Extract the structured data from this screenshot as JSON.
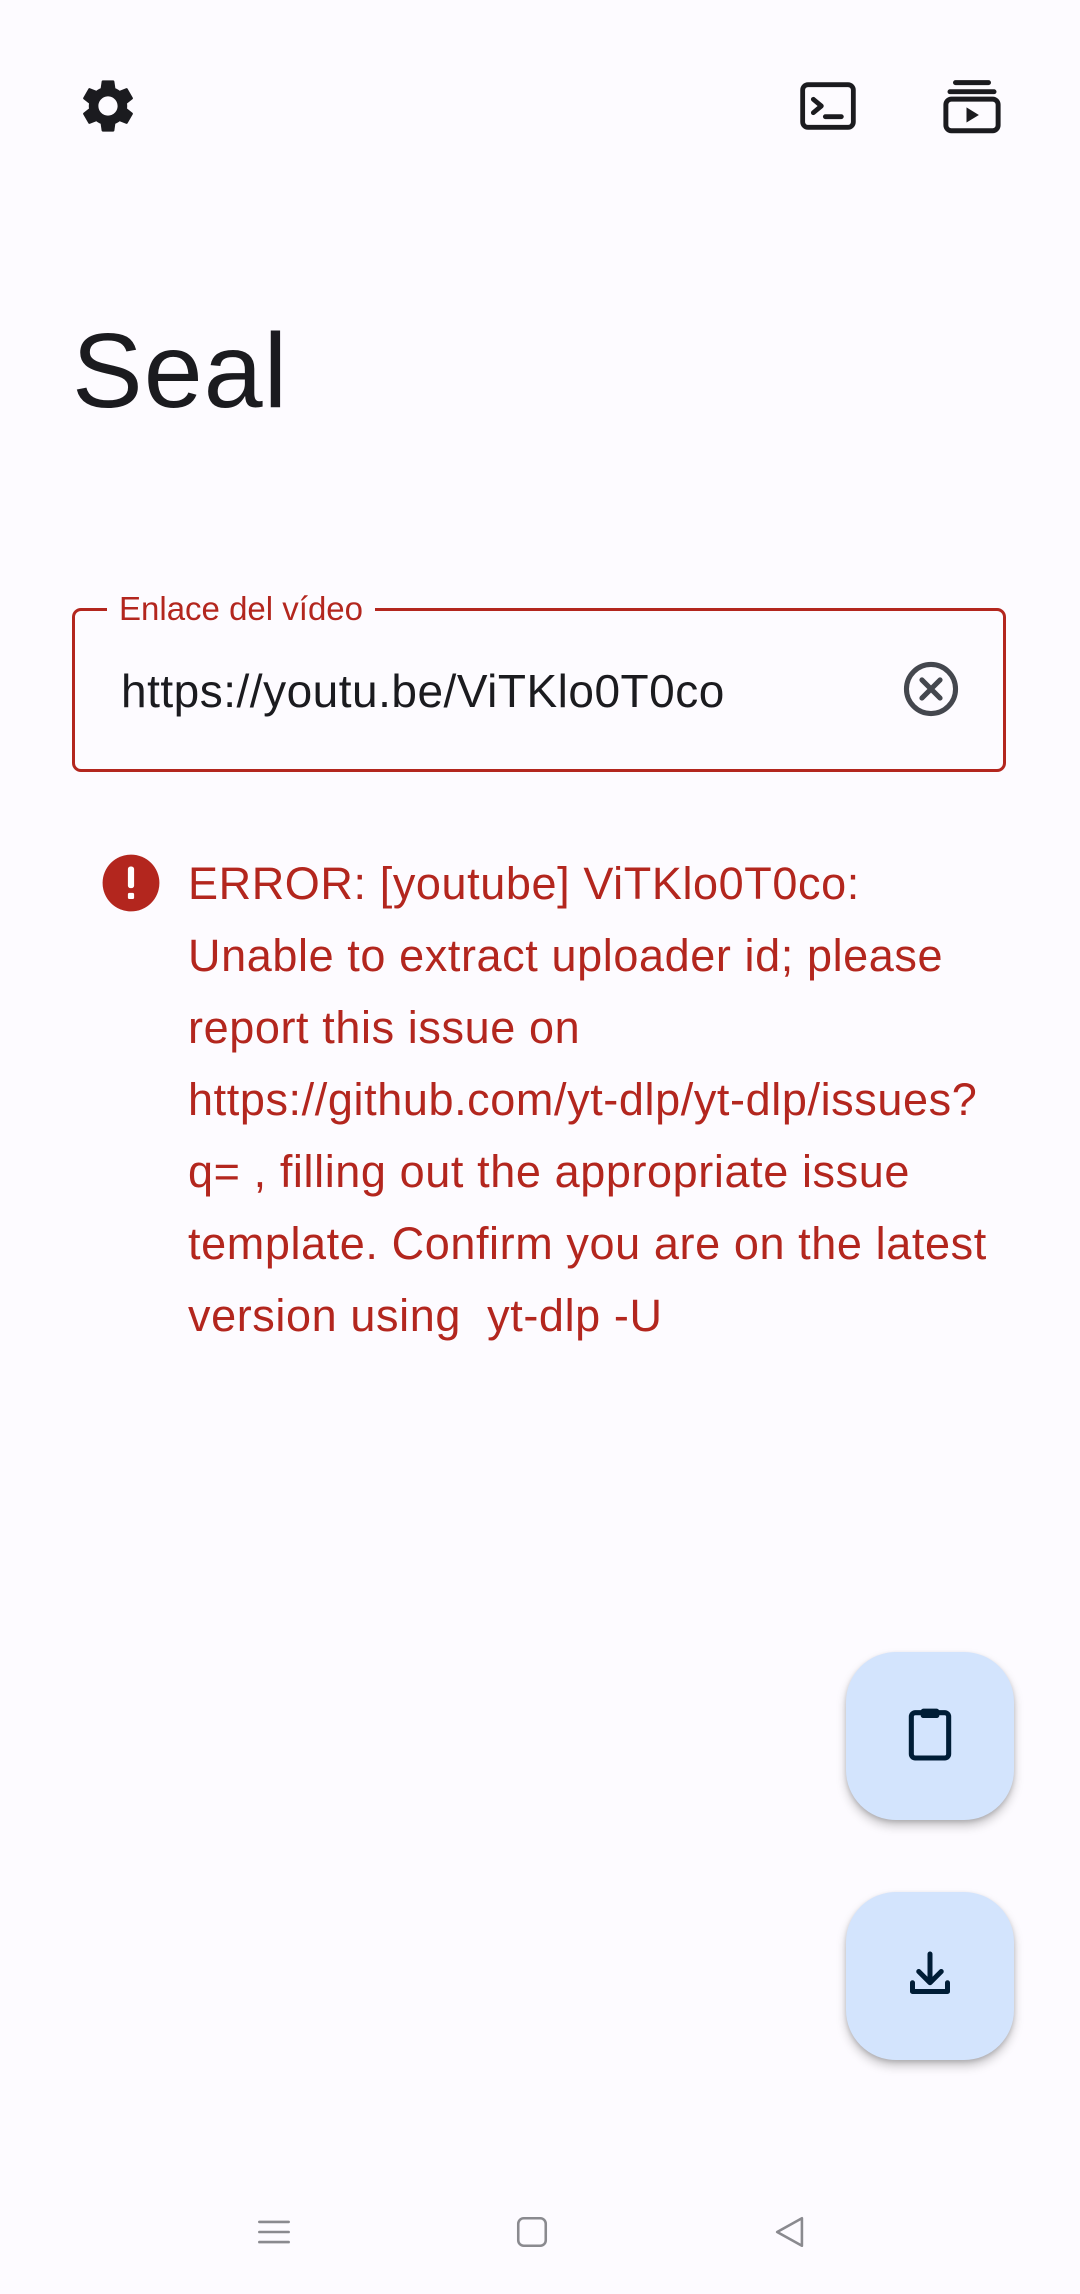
{
  "app": {
    "title": "Seal"
  },
  "toolbar": {
    "settings_icon": "gear-icon",
    "terminal_icon": "terminal-icon",
    "queue_icon": "download-queue-icon"
  },
  "url_input": {
    "label": "Enlace del vídeo",
    "value": "https://youtu.be/ViTKlo0T0co",
    "clear_icon": "clear-circle-icon"
  },
  "error": {
    "icon": "error-icon",
    "message": "ERROR: [youtube] ViTKlo0T0co: Unable to extract uploader id; please report this issue on  https://github.com/yt-dlp/yt-dlp/issues?q= , filling out the appropriate issue template. Confirm you are on the latest version using  yt-dlp -U"
  },
  "fabs": {
    "paste_icon": "clipboard-icon",
    "download_icon": "download-icon"
  },
  "nav": {
    "menu_icon": "recents-icon",
    "home_icon": "home-icon",
    "back_icon": "back-icon"
  },
  "colors": {
    "error": "#b3261e",
    "fab_background": "#d3e4fd",
    "background": "#fdfbff",
    "on_surface": "#1b1b1f",
    "on_fab": "#001d36"
  }
}
